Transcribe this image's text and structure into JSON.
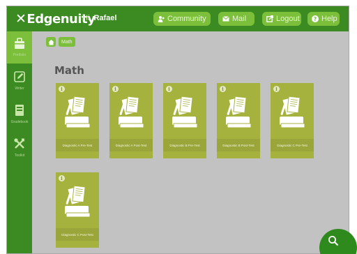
{
  "header": {
    "logo_mark": "✕",
    "logo_text": "Edgenuity",
    "greeting_hi": "Hi",
    "greeting_name": "Rafael",
    "buttons": {
      "community": "Community",
      "mail": "Mail",
      "logout": "Logout",
      "help": "Help"
    }
  },
  "sidebar": {
    "items": [
      {
        "label": "Portfolio",
        "icon": "portfolio-icon",
        "active": true
      },
      {
        "label": "Writer",
        "icon": "writer-icon",
        "active": false
      },
      {
        "label": "Gradebook",
        "icon": "gradebook-icon",
        "active": false
      },
      {
        "label": "Toolkit",
        "icon": "toolkit-icon",
        "active": false
      }
    ]
  },
  "breadcrumb": {
    "items": [
      "Math"
    ]
  },
  "page": {
    "title": "Math"
  },
  "cards": [
    {
      "title": "Diagnostic A Pre-Test",
      "info": "i"
    },
    {
      "title": "Diagnostic A Post-Test",
      "info": "i"
    },
    {
      "title": "Diagnostic B Pre-Test",
      "info": "i"
    },
    {
      "title": "Diagnostic B Post-Test",
      "info": "i"
    },
    {
      "title": "Diagnostic C Pre-Test",
      "info": "i"
    },
    {
      "title": "Diagnostic C Post-Test",
      "info": "i"
    }
  ],
  "colors": {
    "header_green": "#3b8a22",
    "button_green": "#7bbf3a",
    "card_olive": "#a6b23e",
    "content_gray": "#c2c2c2"
  }
}
